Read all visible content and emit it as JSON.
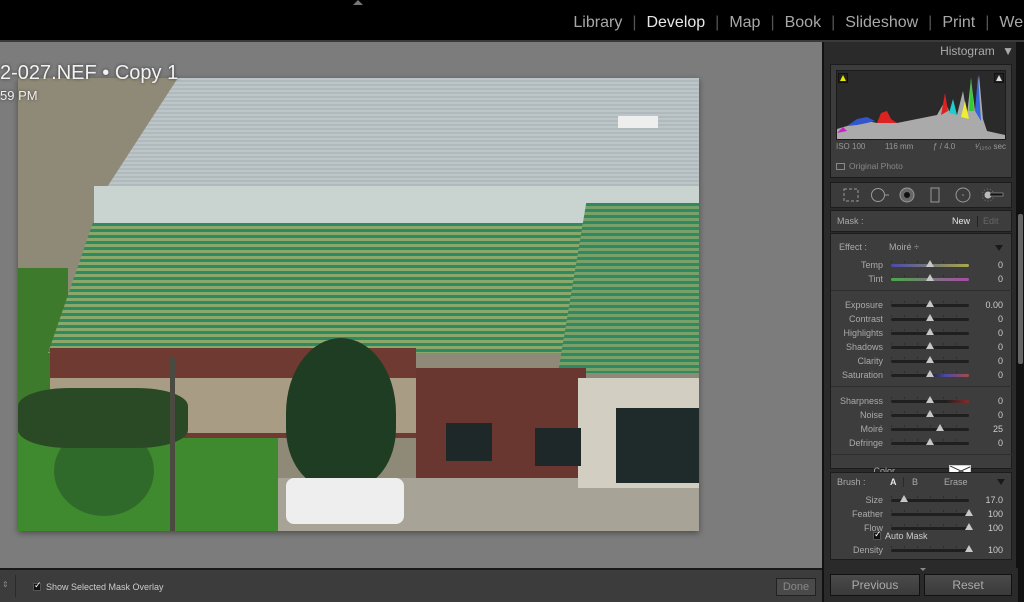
{
  "modules": [
    {
      "label": "Library",
      "active": false
    },
    {
      "label": "Develop",
      "active": true
    },
    {
      "label": "Map",
      "active": false
    },
    {
      "label": "Book",
      "active": false
    },
    {
      "label": "Slideshow",
      "active": false
    },
    {
      "label": "Print",
      "active": false
    },
    {
      "label": "Web",
      "active": false
    }
  ],
  "photo_info": {
    "title": "2-027.NEF  •  Copy 1",
    "subtitle": "59 PM"
  },
  "histogram": {
    "header": "Histogram",
    "iso": "ISO 100",
    "focal_length": "116 mm",
    "aperture": "ƒ / 4.0",
    "shutter": "¹⁄₁₂₅₀ sec",
    "original_photo_label": "Original Photo",
    "original_photo_checked": false
  },
  "tools": [
    {
      "name": "crop-overlay-icon"
    },
    {
      "name": "spot-removal-icon"
    },
    {
      "name": "red-eye-icon"
    },
    {
      "name": "graduated-filter-icon"
    },
    {
      "name": "radial-filter-icon"
    },
    {
      "name": "adjustment-brush-icon"
    }
  ],
  "mask": {
    "label": "Mask :",
    "new_label": "New",
    "edit_label": "Edit"
  },
  "effect": {
    "label": "Effect :",
    "value": "Moiré ÷"
  },
  "slider_groups": [
    [
      {
        "name": "Temp",
        "value": "0",
        "position": 0.5
      },
      {
        "name": "Tint",
        "value": "0",
        "position": 0.5
      }
    ],
    [
      {
        "name": "Exposure",
        "value": "0.00",
        "position": 0.5
      },
      {
        "name": "Contrast",
        "value": "0",
        "position": 0.5
      },
      {
        "name": "Highlights",
        "value": "0",
        "position": 0.5
      },
      {
        "name": "Shadows",
        "value": "0",
        "position": 0.5
      },
      {
        "name": "Clarity",
        "value": "0",
        "position": 0.5
      },
      {
        "name": "Saturation",
        "value": "0",
        "position": 0.5
      }
    ],
    [
      {
        "name": "Sharpness",
        "value": "0",
        "position": 0.5
      },
      {
        "name": "Noise",
        "value": "0",
        "position": 0.5
      },
      {
        "name": "Moiré",
        "value": "25",
        "position": 0.625
      },
      {
        "name": "Defringe",
        "value": "0",
        "position": 0.5
      }
    ]
  ],
  "color": {
    "label": "Color"
  },
  "brush": {
    "label": "Brush :",
    "a_label": "A",
    "b_label": "B",
    "erase_label": "Erase",
    "sliders": [
      {
        "name": "Size",
        "value": "17.0",
        "position": 0.17
      },
      {
        "name": "Feather",
        "value": "100",
        "position": 1.0
      },
      {
        "name": "Flow",
        "value": "100",
        "position": 1.0
      }
    ],
    "auto_mask_label": "Auto Mask",
    "auto_mask_checked": true,
    "density": {
      "name": "Density",
      "value": "100",
      "position": 1.0
    }
  },
  "bottom": {
    "show_overlay_label": "Show Selected Mask Overlay",
    "show_overlay_checked": true,
    "done_label": "Done",
    "previous_label": "Previous",
    "reset_label": "Reset"
  }
}
